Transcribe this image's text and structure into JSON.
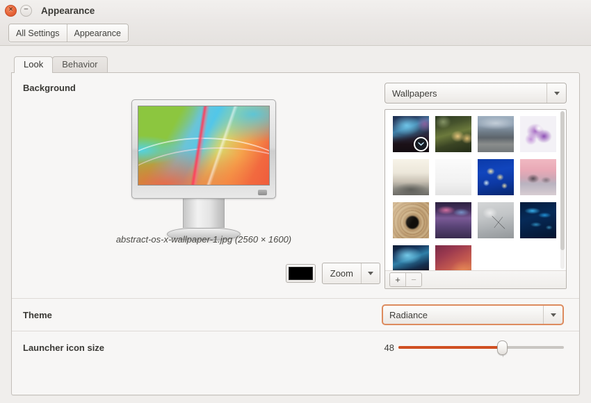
{
  "window": {
    "title": "Appearance",
    "close_icon": "close-icon",
    "minimize_icon": "minimize-icon",
    "close_glyph": "×",
    "minimize_glyph": "−"
  },
  "toolbar": {
    "all_settings_label": "All Settings",
    "appearance_label": "Appearance"
  },
  "tabs": [
    {
      "label": "Look",
      "active": true
    },
    {
      "label": "Behavior",
      "active": false
    }
  ],
  "background": {
    "section_title": "Background",
    "filename": "abstract-os-x-wallpaper-1.jpg (2560 × 1600)",
    "color_swatch": "#000000",
    "color_swatch_name": "background-color-swatch",
    "scaling_label": "Zoom",
    "source_label": "Wallpapers",
    "add_label": "+",
    "remove_label": "−",
    "thumbnails": [
      {
        "name": "milky-way-night-sky",
        "selected": true
      },
      {
        "name": "mushrooms-forest",
        "selected": false
      },
      {
        "name": "grey-beach-shore",
        "selected": false
      },
      {
        "name": "purple-blossom",
        "selected": false
      },
      {
        "name": "foggy-forest-pale",
        "selected": false
      },
      {
        "name": "white-minimal-curve",
        "selected": false
      },
      {
        "name": "blue-jellyfish",
        "selected": false
      },
      {
        "name": "pink-lake-reflection",
        "selected": false
      },
      {
        "name": "wooden-spiral-tunnel",
        "selected": false
      },
      {
        "name": "purple-wet-street",
        "selected": false
      },
      {
        "name": "airplane-grey-sky",
        "selected": false
      },
      {
        "name": "blue-digital-abstract",
        "selected": false
      },
      {
        "name": "milky-way-mountain",
        "selected": false
      },
      {
        "name": "pink-red-gradient",
        "selected": false
      }
    ]
  },
  "theme": {
    "section_title": "Theme",
    "selected": "Radiance"
  },
  "launcher": {
    "section_title": "Launcher icon size",
    "value": "48",
    "min": 16,
    "max": 64,
    "percent": 63
  },
  "colors": {
    "accent_orange": "#cf4f22",
    "focus_border": "#dd8b5e",
    "panel_bg": "#f7f6f5",
    "window_bg": "#f0eeec"
  }
}
